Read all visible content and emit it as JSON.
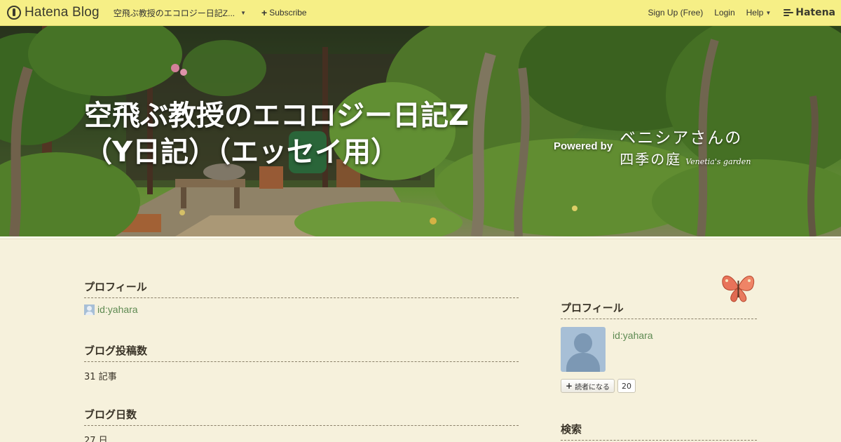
{
  "topbar": {
    "logo_text": "Hatena Blog",
    "blog_name": "空飛ぶ教授のエコロジー日記Z...",
    "subscribe_label": "Subscribe",
    "signup_label": "Sign Up (Free)",
    "login_label": "Login",
    "help_label": "Help",
    "brand_label": "Hatena",
    "background_color": "#f6ef86"
  },
  "header": {
    "title": "空飛ぶ教授のエコロジー日記Z\n（Y日記）（エッセイ用）",
    "powered_by": "Powered by",
    "theme_line1": "ベニシアさんの",
    "theme_line2": "四季の庭",
    "theme_script": "Venetia's garden"
  },
  "main": {
    "sections": [
      {
        "title": "プロフィール",
        "value": "id:yahara"
      },
      {
        "title": "ブログ投稿数",
        "value": "31 記事"
      },
      {
        "title": "ブログ日数",
        "value": "27 日"
      }
    ]
  },
  "sidebar": {
    "profile_title": "プロフィール",
    "profile_id": "id:yahara",
    "subscribe_button": "読者になる",
    "subscriber_count": "20",
    "search_title": "検索"
  },
  "colors": {
    "page_background": "#f6f1dc",
    "link": "#5e8a52",
    "avatar": "#a7bfd6"
  }
}
